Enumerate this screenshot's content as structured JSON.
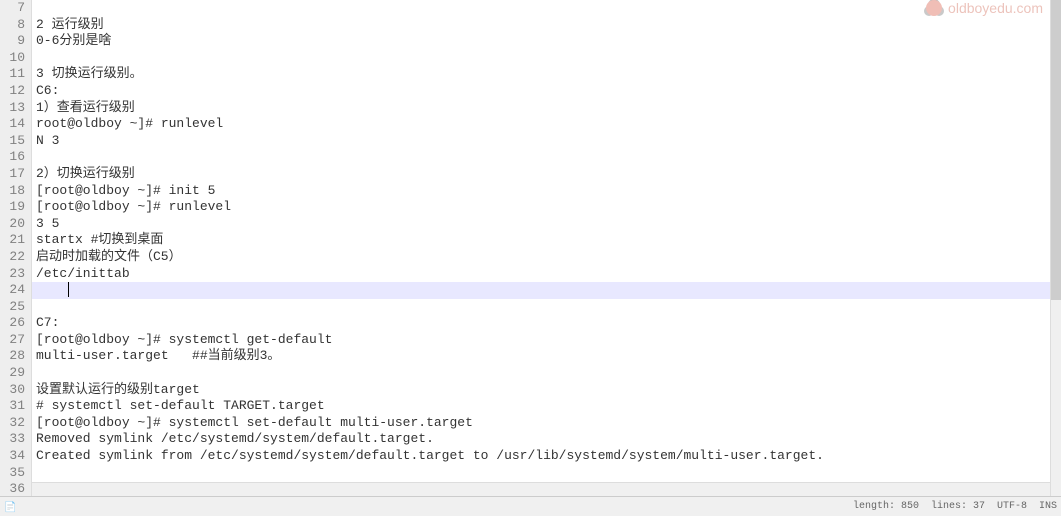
{
  "lines": [
    {
      "num": 7,
      "text": ""
    },
    {
      "num": 8,
      "text": "2 运行级别"
    },
    {
      "num": 9,
      "text": "0-6分别是啥"
    },
    {
      "num": 10,
      "text": ""
    },
    {
      "num": 11,
      "text": "3 切换运行级别。"
    },
    {
      "num": 12,
      "text": "C6:"
    },
    {
      "num": 13,
      "text": "1）查看运行级别"
    },
    {
      "num": 14,
      "text": "root@oldboy ~]# runlevel"
    },
    {
      "num": 15,
      "text": "N 3"
    },
    {
      "num": 16,
      "text": ""
    },
    {
      "num": 17,
      "text": "2）切换运行级别"
    },
    {
      "num": 18,
      "text": "[root@oldboy ~]# init 5"
    },
    {
      "num": 19,
      "text": "[root@oldboy ~]# runlevel"
    },
    {
      "num": 20,
      "text": "3 5"
    },
    {
      "num": 21,
      "text": "startx #切换到桌面"
    },
    {
      "num": 22,
      "text": "启动时加载的文件（C5）"
    },
    {
      "num": 23,
      "text": "/etc/inittab"
    },
    {
      "num": 24,
      "text": "",
      "highlighted": true
    },
    {
      "num": 25,
      "text": ""
    },
    {
      "num": 26,
      "text": "C7:"
    },
    {
      "num": 27,
      "text": "[root@oldboy ~]# systemctl get-default"
    },
    {
      "num": 28,
      "text": "multi-user.target   ##当前级别3。"
    },
    {
      "num": 29,
      "text": ""
    },
    {
      "num": 30,
      "text": "设置默认运行的级别target"
    },
    {
      "num": 31,
      "text": "# systemctl set-default TARGET.target"
    },
    {
      "num": 32,
      "text": "[root@oldboy ~]# systemctl set-default multi-user.target"
    },
    {
      "num": 33,
      "text": "Removed symlink /etc/systemd/system/default.target."
    },
    {
      "num": 34,
      "text": "Created symlink from /etc/systemd/system/default.target to /usr/lib/systemd/system/multi-user.target."
    },
    {
      "num": 35,
      "text": ""
    },
    {
      "num": 36,
      "text": ""
    }
  ],
  "watermark": "oldboyedu.com",
  "statusbar": {
    "length": "length: 850",
    "lines": "lines: 37",
    "encoding": "UTF-8",
    "ins": "INS"
  }
}
